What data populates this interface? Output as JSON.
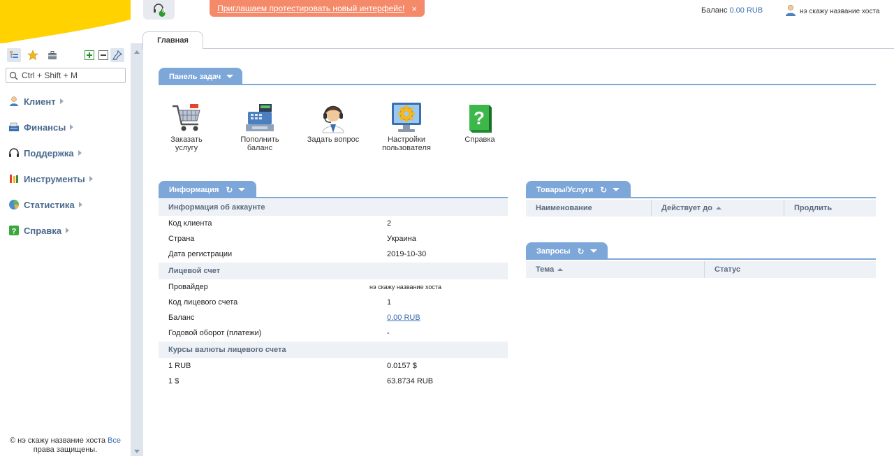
{
  "colors": {
    "accent": "#7da6d9",
    "promo": "#f58a6b",
    "logo": "#ffd200",
    "link": "#3a6fb0"
  },
  "sidebar": {
    "toolbar_icons": [
      "tree-icon",
      "star-icon",
      "briefcase-icon",
      "expand-icon",
      "collapse-icon",
      "pin-icon"
    ],
    "search_placeholder": "Ctrl + Shift + M",
    "items": [
      {
        "label": "Клиент",
        "icon": "client-icon"
      },
      {
        "label": "Финансы",
        "icon": "finance-icon"
      },
      {
        "label": "Поддержка",
        "icon": "support-icon"
      },
      {
        "label": "Инструменты",
        "icon": "tools-icon"
      },
      {
        "label": "Статистика",
        "icon": "statistics-icon"
      },
      {
        "label": "Справка",
        "icon": "help-icon"
      }
    ],
    "footer_prefix": "© нэ скажу название хоста ",
    "footer_link": "Все",
    "footer_suffix": "права защищены."
  },
  "topbar": {
    "notify_count": "0",
    "promo_text": "Приглашаем протестировать новый интерфейс!",
    "promo_close": "×",
    "balance_label": "Баланс ",
    "balance_value": "0.00 RUB",
    "user_name": "нэ скажу название хоста"
  },
  "tabs": {
    "home": "Главная"
  },
  "task_panel": {
    "title": "Панель задач",
    "tasks": [
      {
        "label": "Заказать услугу",
        "icon": "cart-icon"
      },
      {
        "label": "Пополнить баланс",
        "icon": "cash-register-icon"
      },
      {
        "label": "Задать вопрос",
        "icon": "operator-icon"
      },
      {
        "label": "Настройки пользователя",
        "icon": "settings-monitor-icon"
      },
      {
        "label": "Справка",
        "icon": "help-book-icon"
      }
    ]
  },
  "info": {
    "title": "Информация",
    "groups": {
      "account": "Информация об аккаунте",
      "personal": "Лицевой счет",
      "rates": "Курсы валюты лицевого счета"
    },
    "rows": [
      {
        "k": "Код клиента",
        "v": "2"
      },
      {
        "k": "Страна",
        "v": "Украина"
      },
      {
        "k": "Дата регистрации",
        "v": "2019-10-30"
      },
      {
        "k": "Провайдер",
        "v": "нэ скажу название хоста"
      },
      {
        "k": "Код лицевого счета",
        "v": "1"
      },
      {
        "k": "Баланс",
        "v": "0.00 RUB"
      },
      {
        "k": "Годовой оборот (платежи)",
        "v": "-"
      },
      {
        "k": "1 RUB",
        "v": "0.0157 $"
      },
      {
        "k": "1 $",
        "v": "63.8734 RUB"
      }
    ]
  },
  "goods": {
    "title": "Товары/Услуги",
    "columns": [
      "Наименование",
      "Действует до",
      "Продлить"
    ]
  },
  "requests": {
    "title": "Запросы",
    "columns": [
      "Тема",
      "Статус"
    ]
  }
}
